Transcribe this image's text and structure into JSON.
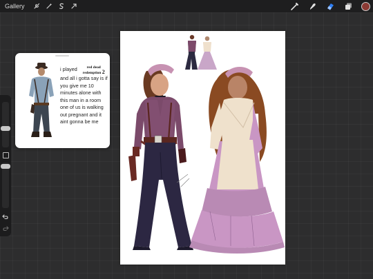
{
  "topbar": {
    "gallery_label": "Gallery",
    "left_tools": [
      "wrench-icon",
      "magic-wand-icon",
      "selection-icon",
      "transform-arrow-icon"
    ],
    "right_tools": [
      "brush-icon",
      "smudge-icon",
      "eraser-icon",
      "layers-icon"
    ],
    "active_tool": "eraser-icon",
    "active_tool_color": "#2f7ff5",
    "current_color": "#8c3a34"
  },
  "sidebar": {
    "controls": [
      "brush-size-slider",
      "modify-button",
      "opacity-slider",
      "undo-icon",
      "redo-icon"
    ]
  },
  "reference": {
    "meme": {
      "line1_prefix": "i played",
      "logo_line1": "red dead",
      "logo_line2": "redemption",
      "logo_number": "2",
      "body": "and all i gotta say is if you give me 10 minutes alone with this man in a room one of us is walking out pregnant and it aint gonna be me"
    }
  },
  "colors": {
    "canvas_bg": "#ffffff",
    "app_bg": "#2d2d2e",
    "bar_bg": "#1e1e1f"
  }
}
